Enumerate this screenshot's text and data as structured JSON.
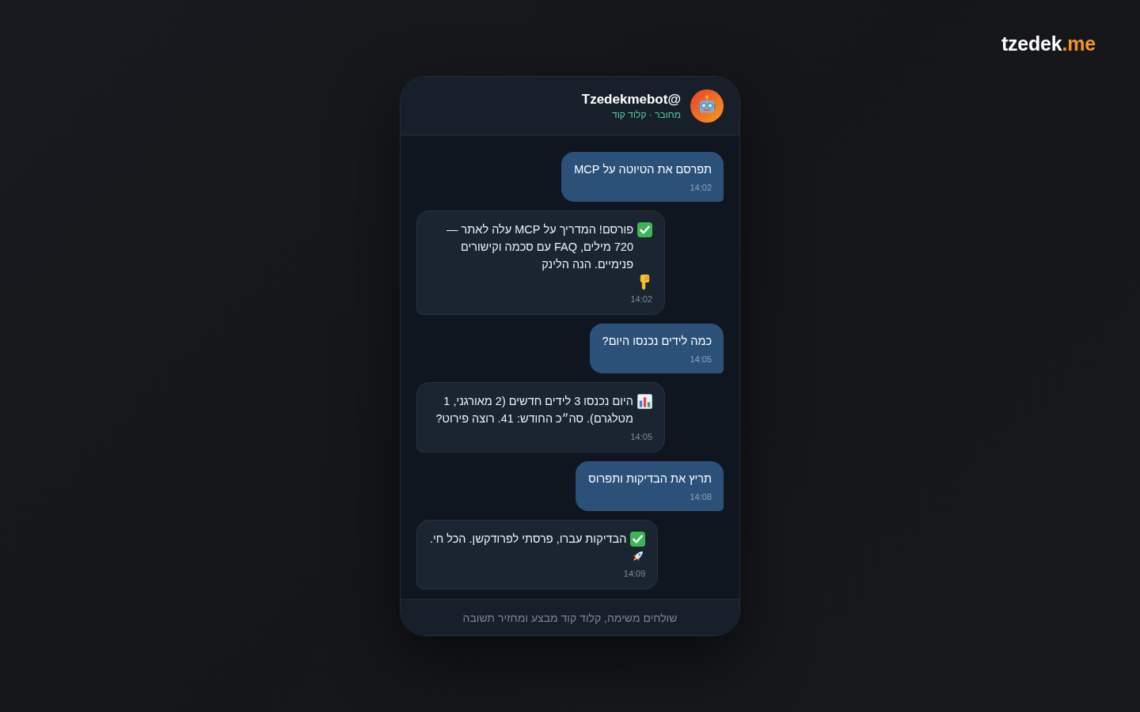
{
  "brand": {
    "name": "tzedek",
    "accent": ".me"
  },
  "chat": {
    "title": "@Tzedekmebot",
    "status": "מחובר · קלוד קוד"
  },
  "messages": [
    {
      "kind": "sent",
      "text": "תפרסם את הטיוטה על MCP",
      "time": "14:02"
    },
    {
      "kind": "received",
      "lead_icon": {
        "kind": "check"
      },
      "text": "פורסם! המדריך על MCP עלה לאתר — 720 מילים, FAQ עם סכמה וקישורים פנימיים. הנה הלינק",
      "trail_icon": {
        "kind": "pointing-hand"
      },
      "time": "14:02"
    },
    {
      "kind": "sent",
      "text": "כמה לידים נכנסו היום?",
      "time": "14:05"
    },
    {
      "kind": "received",
      "lead_icon": {
        "kind": "bar-chart"
      },
      "text": "היום נכנסו 3 לידים חדשים (2 מאורגני, 1 מטלגרם). סה״כ החודש: 41. רוצה פירוט?",
      "time": "14:05"
    },
    {
      "kind": "sent",
      "text": "תריץ את הבדיקות ותפרוס",
      "time": "14:08"
    },
    {
      "kind": "received",
      "lead_icon": {
        "kind": "check"
      },
      "text": "הבדיקות עברו, פרסתי לפרודקשן. הכל חי.",
      "trail_icon": {
        "kind": "rocket"
      },
      "time": "14:09"
    }
  ],
  "footer": {
    "note": "שולחים משימה, קלוד קוד מבצע ומחזיר תשובה"
  }
}
